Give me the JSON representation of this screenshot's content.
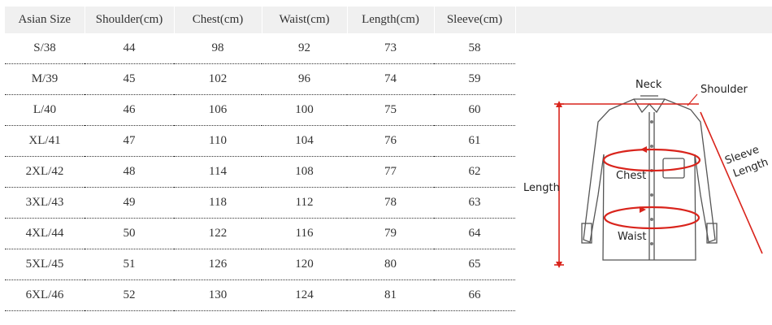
{
  "table": {
    "headers": [
      "Asian Size",
      "Shoulder(cm)",
      "Chest(cm)",
      "Waist(cm)",
      "Length(cm)",
      "Sleeve(cm)"
    ],
    "rows": [
      [
        "S/38",
        "44",
        "98",
        "92",
        "73",
        "58"
      ],
      [
        "M/39",
        "45",
        "102",
        "96",
        "74",
        "59"
      ],
      [
        "L/40",
        "46",
        "106",
        "100",
        "75",
        "60"
      ],
      [
        "XL/41",
        "47",
        "110",
        "104",
        "76",
        "61"
      ],
      [
        "2XL/42",
        "48",
        "114",
        "108",
        "77",
        "62"
      ],
      [
        "3XL/43",
        "49",
        "118",
        "112",
        "78",
        "63"
      ],
      [
        "4XL/44",
        "50",
        "122",
        "116",
        "79",
        "64"
      ],
      [
        "5XL/45",
        "51",
        "126",
        "120",
        "80",
        "65"
      ],
      [
        "6XL/46",
        "52",
        "130",
        "124",
        "81",
        "66"
      ]
    ]
  },
  "diagram": {
    "labels": {
      "neck": "Neck",
      "shoulder": "Shoulder",
      "sleeve_line1": "Sleeve",
      "sleeve_line2": "Length",
      "chest": "Chest",
      "length": "Length",
      "waist": "Waist"
    },
    "icon": "shirt-icon",
    "colors": {
      "measure": "#d9241c",
      "outline": "#555555"
    }
  }
}
